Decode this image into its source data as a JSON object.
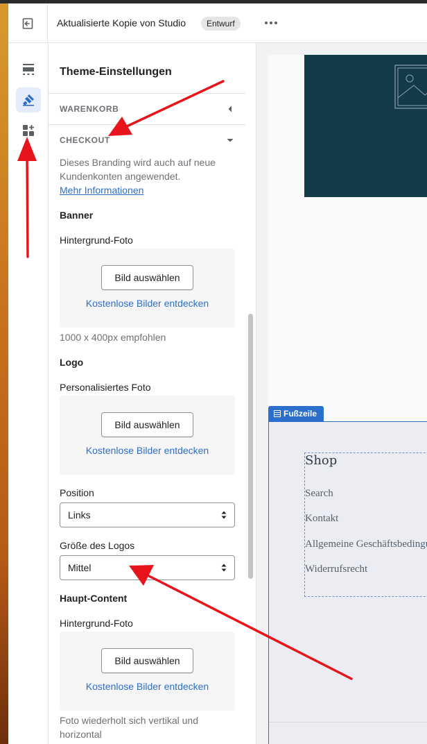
{
  "topbar": {
    "theme_name": "Aktualisierte Kopie von Studio",
    "status_badge": "Entwurf"
  },
  "rail": {
    "items": [
      {
        "icon": "sections-icon",
        "active": false
      },
      {
        "icon": "theme-settings-brush-icon",
        "active": true
      },
      {
        "icon": "app-blocks-icon",
        "active": false
      }
    ]
  },
  "panel": {
    "title": "Theme-Einstellungen",
    "sections": {
      "cart": "WARENKORB",
      "checkout": "CHECKOUT"
    },
    "checkout": {
      "help_text": "Dieses Branding wird auch auf neue Kundenkonten angewendet.",
      "help_link": "Mehr Informationen",
      "banner": {
        "heading": "Banner",
        "background_label": "Hintergrund-Foto",
        "select_button": "Bild auswählen",
        "free_images_link": "Kostenlose Bilder entdecken",
        "recommendation": "1000 x 400px empfohlen"
      },
      "logo": {
        "heading": "Logo",
        "photo_label": "Personalisiertes Foto",
        "select_button": "Bild auswählen",
        "free_images_link": "Kostenlose Bilder entdecken",
        "position_label": "Position",
        "position_value": "Links",
        "size_label": "Größe des Logos",
        "size_value": "Mittel"
      },
      "main_content": {
        "heading": "Haupt-Content",
        "background_label": "Hintergrund-Foto",
        "select_button": "Bild auswählen",
        "free_images_link": "Kostenlose Bilder entdecken",
        "repeat_note": "Foto wiederholt sich vertikal und horizontal"
      }
    }
  },
  "preview": {
    "footer_tag": "Fußzeile",
    "footer_menu": {
      "title": "Shop",
      "links": [
        "Search",
        "Kontakt",
        "Allgemeine Geschäftsbedingungen",
        "Widerrufsrecht"
      ]
    }
  },
  "colors": {
    "accent": "#2c6ecb",
    "hero": "#123a47",
    "annotation": "#e8141c"
  }
}
